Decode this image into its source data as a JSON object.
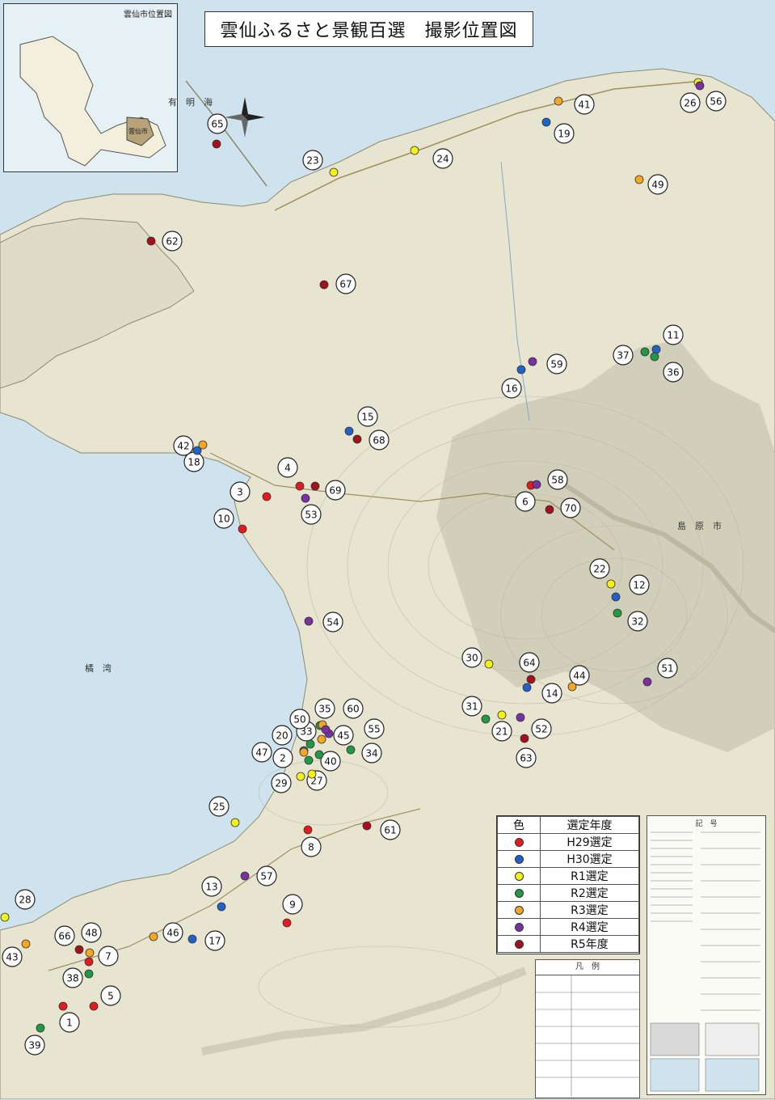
{
  "title": "雲仙ふるさと景観百選　撮影位置図",
  "inset": {
    "title": "雲仙市位置図"
  },
  "place_labels": [
    "有　明　海",
    "橘　湾",
    "島　原　市",
    "雲仙市"
  ],
  "legend": {
    "headers": [
      "色",
      "選定年度"
    ],
    "items": [
      {
        "label": "H29選定",
        "color": "#e41a1c"
      },
      {
        "label": "H30選定",
        "color": "#1f62c9"
      },
      {
        "label": "R1選定",
        "color": "#f4f116"
      },
      {
        "label": "R2選定",
        "color": "#1d9a43"
      },
      {
        "label": "R3選定",
        "color": "#f5a623"
      },
      {
        "label": "R4選定",
        "color": "#7b2fa5"
      },
      {
        "label": "R5年度",
        "color": "#a5101c"
      }
    ]
  },
  "map_key": {
    "title": "記　号"
  },
  "notes": {
    "title": "凡　例"
  },
  "markers": [
    {
      "id": "1",
      "year": "H29"
    },
    {
      "id": "2",
      "year": "R2"
    },
    {
      "id": "3",
      "year": "H29"
    },
    {
      "id": "4",
      "year": "H29"
    },
    {
      "id": "5",
      "year": "H29"
    },
    {
      "id": "6",
      "year": "H29"
    },
    {
      "id": "7",
      "year": "H29"
    },
    {
      "id": "8",
      "year": "H29"
    },
    {
      "id": "9",
      "year": "H29"
    },
    {
      "id": "10",
      "year": "H29"
    },
    {
      "id": "11",
      "year": "H30"
    },
    {
      "id": "12",
      "year": "H30"
    },
    {
      "id": "13",
      "year": "H30"
    },
    {
      "id": "14",
      "year": "H30"
    },
    {
      "id": "15",
      "year": "H30"
    },
    {
      "id": "16",
      "year": "H30"
    },
    {
      "id": "17",
      "year": "H30"
    },
    {
      "id": "18",
      "year": "H30"
    },
    {
      "id": "19",
      "year": "H30"
    },
    {
      "id": "20",
      "year": "H30"
    },
    {
      "id": "21",
      "year": "R1"
    },
    {
      "id": "22",
      "year": "R1"
    },
    {
      "id": "23",
      "year": "R1"
    },
    {
      "id": "24",
      "year": "R1"
    },
    {
      "id": "25",
      "year": "R1"
    },
    {
      "id": "26",
      "year": "R1"
    },
    {
      "id": "27",
      "year": "R1"
    },
    {
      "id": "28",
      "year": "R1"
    },
    {
      "id": "29",
      "year": "R1"
    },
    {
      "id": "30",
      "year": "R1"
    },
    {
      "id": "31",
      "year": "R2"
    },
    {
      "id": "32",
      "year": "R2"
    },
    {
      "id": "33",
      "year": "R2"
    },
    {
      "id": "34",
      "year": "R2"
    },
    {
      "id": "35",
      "year": "R2"
    },
    {
      "id": "36",
      "year": "R2"
    },
    {
      "id": "37",
      "year": "R2"
    },
    {
      "id": "38",
      "year": "R2"
    },
    {
      "id": "39",
      "year": "R2"
    },
    {
      "id": "40",
      "year": "R2"
    },
    {
      "id": "41",
      "year": "R3"
    },
    {
      "id": "42",
      "year": "R3"
    },
    {
      "id": "43",
      "year": "R3"
    },
    {
      "id": "44",
      "year": "R3"
    },
    {
      "id": "45",
      "year": "R3"
    },
    {
      "id": "46",
      "year": "R3"
    },
    {
      "id": "47",
      "year": "R3"
    },
    {
      "id": "48",
      "year": "R3"
    },
    {
      "id": "49",
      "year": "R3"
    },
    {
      "id": "50",
      "year": "R3"
    },
    {
      "id": "51",
      "year": "R4"
    },
    {
      "id": "52",
      "year": "R4"
    },
    {
      "id": "53",
      "year": "R4"
    },
    {
      "id": "54",
      "year": "R4"
    },
    {
      "id": "55",
      "year": "R4"
    },
    {
      "id": "56",
      "year": "R4"
    },
    {
      "id": "57",
      "year": "R4"
    },
    {
      "id": "58",
      "year": "R4"
    },
    {
      "id": "59",
      "year": "R4"
    },
    {
      "id": "60",
      "year": "R4"
    },
    {
      "id": "61",
      "year": "R5"
    },
    {
      "id": "62",
      "year": "R5"
    },
    {
      "id": "63",
      "year": "R5"
    },
    {
      "id": "64",
      "year": "R5"
    },
    {
      "id": "65",
      "year": "R5"
    },
    {
      "id": "66",
      "year": "R5"
    },
    {
      "id": "67",
      "year": "R5"
    },
    {
      "id": "68",
      "year": "R5"
    },
    {
      "id": "69",
      "year": "R5"
    },
    {
      "id": "70",
      "year": "R5"
    }
  ]
}
